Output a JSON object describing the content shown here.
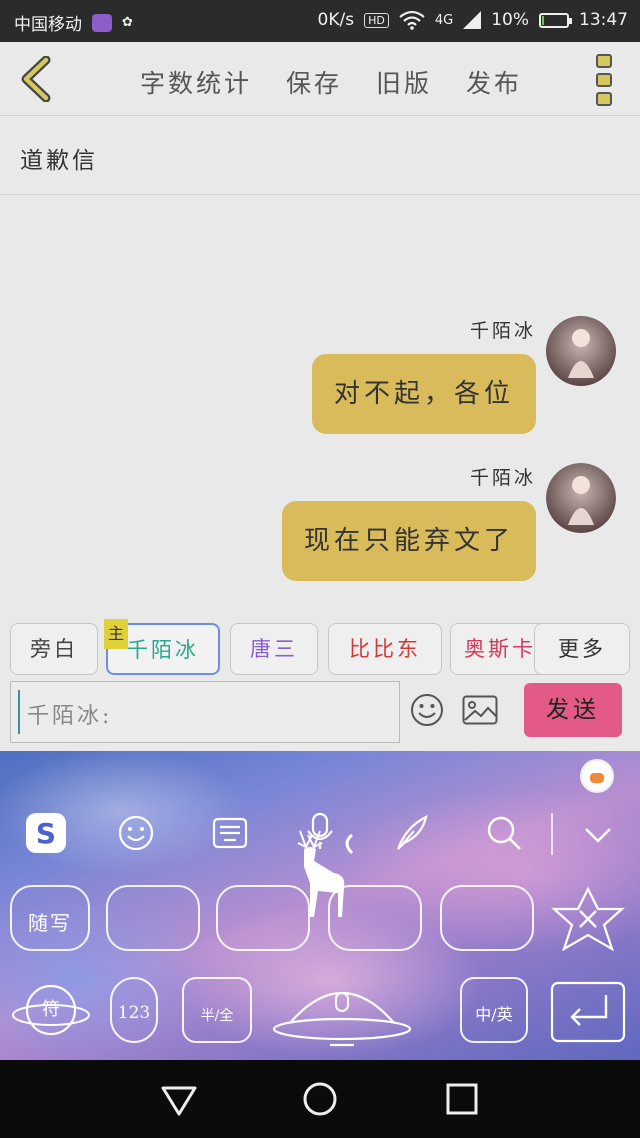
{
  "status_bar": {
    "carrier": "中国移动",
    "net_speed": "0K/s",
    "hd": "HD",
    "network": "4G",
    "battery": "10%",
    "battery_level": 0.1,
    "time": "13:47"
  },
  "toolbar": {
    "items": [
      "字数统计",
      "保存",
      "旧版",
      "发布"
    ]
  },
  "document": {
    "title": "道歉信"
  },
  "messages": [
    {
      "name": "千陌冰",
      "text": "对不起，各位"
    },
    {
      "name": "千陌冰",
      "text": "现在只能弃文了"
    }
  ],
  "roles": {
    "items": [
      {
        "label": "旁白",
        "color": "#444444"
      },
      {
        "label": "千陌冰",
        "color": "#2aa88f",
        "badge": "主"
      },
      {
        "label": "唐三",
        "color": "#8a5dd0"
      },
      {
        "label": "比比东",
        "color": "#d23a3a"
      },
      {
        "label": "奥斯卡",
        "color": "#d23a5a"
      }
    ],
    "more": "更多"
  },
  "input": {
    "placeholder": "千陌冰:",
    "send": "发送"
  },
  "keyboard": {
    "handwrite": "随写",
    "numbers": "123",
    "half_full": "半/全",
    "lang": "中/英"
  },
  "colors": {
    "bubble": "#d9bb5c",
    "send": "#e35a86",
    "accent_border": "#6b8ee8"
  }
}
